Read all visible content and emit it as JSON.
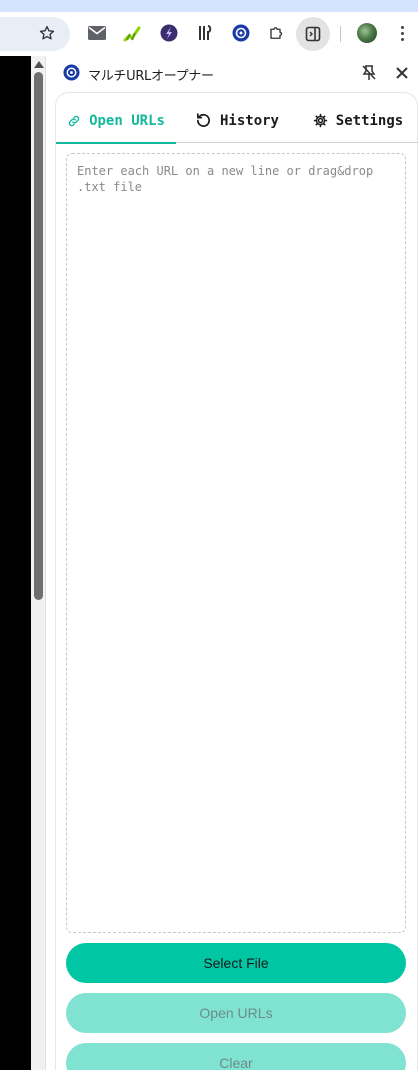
{
  "browser": {
    "colors": {
      "accent_bg": "#d3e3fd",
      "toolbar_bg": "#ffffff"
    },
    "toolbar_icons": [
      "star-icon",
      "mail-icon",
      "chart-extension-icon",
      "purple-extension-icon",
      "tools-extension-icon",
      "blue-badge-extension-icon",
      "puzzle-icon",
      "side-panel-icon",
      "avatar",
      "kebab-menu-icon"
    ]
  },
  "panel": {
    "title": "マルチURLオープナー",
    "tabs": [
      {
        "label": "Open URLs",
        "icon": "link-icon",
        "active": true
      },
      {
        "label": "History",
        "icon": "history-icon",
        "active": false
      },
      {
        "label": "Settings",
        "icon": "gear-icon",
        "active": false
      }
    ],
    "url_input": {
      "value": "",
      "placeholder": "Enter each URL on a new line or drag&drop .txt file"
    },
    "buttons": {
      "select_file": "Select File",
      "open_urls": "Open URLs",
      "clear": "Clear"
    },
    "colors": {
      "accent": "#14b89c",
      "primary_button": "#00c6a4",
      "disabled_button": "#80e3d2"
    }
  }
}
